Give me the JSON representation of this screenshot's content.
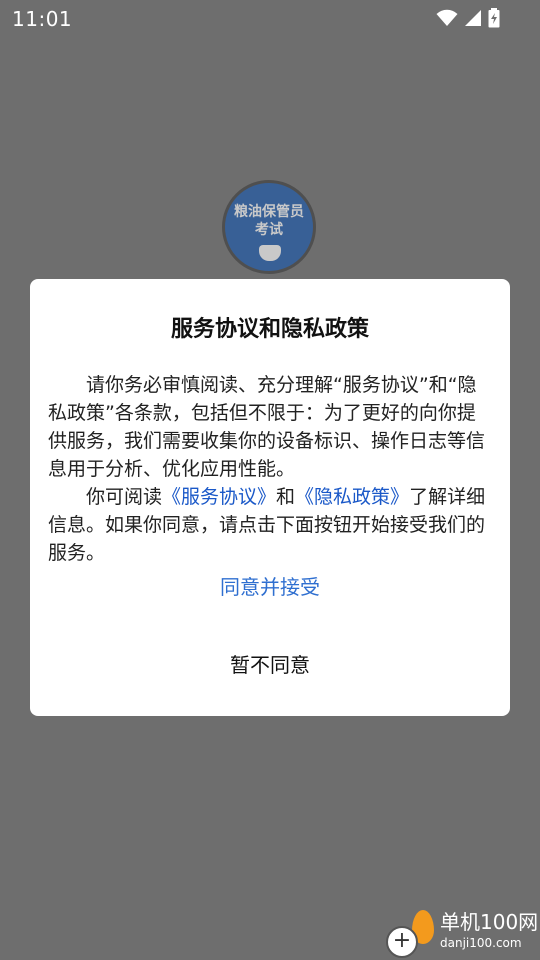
{
  "status_bar": {
    "time": "11:01",
    "icons": [
      "wifi-icon",
      "cellular-signal-icon",
      "battery-charging-icon"
    ]
  },
  "app_logo": {
    "line1": "粮油保管员",
    "line2": "考试"
  },
  "dialog": {
    "title": "服务协议和隐私政策",
    "paragraph1": "请你务必审慎阅读、充分理解“服务协议”和“隐私政策”各条款，包括但不限于：为了更好的向你提供服务，我们需要收集你的设备标识、操作日志等信息用于分析、优化应用性能。",
    "p2_prefix": "你可阅读",
    "service_link": "《服务协议》",
    "p2_and": "和",
    "privacy_link": "《隐私政策》",
    "p2_suffix": "了解详细信息。如果你同意，请点击下面按钮开始接受我们的服务。",
    "agree_label": "同意并接受",
    "decline_label": "暂不同意"
  },
  "watermark": {
    "title": "单机100网",
    "url": "danji100.com"
  },
  "colors": {
    "overlay": "#6e6e6e",
    "link": "#1a58c8",
    "agree": "#2f6fd0"
  }
}
